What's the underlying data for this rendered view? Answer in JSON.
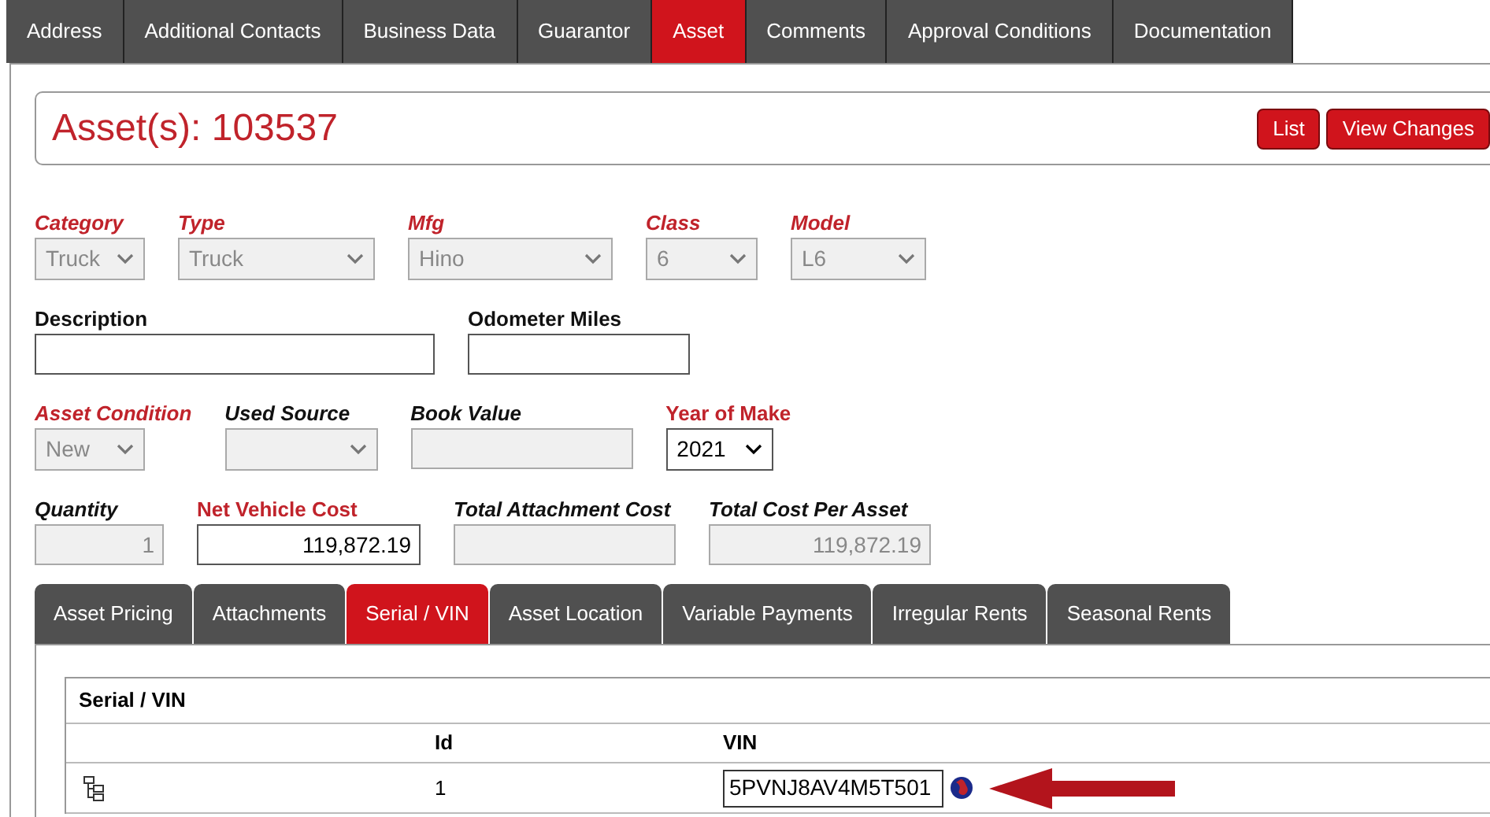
{
  "tabs": [
    {
      "label": "Address",
      "selected": false
    },
    {
      "label": "Additional Contacts",
      "selected": false
    },
    {
      "label": "Business Data",
      "selected": false
    },
    {
      "label": "Guarantor",
      "selected": false
    },
    {
      "label": "Asset",
      "selected": true
    },
    {
      "label": "Comments",
      "selected": false
    },
    {
      "label": "Approval Conditions",
      "selected": false
    },
    {
      "label": "Documentation",
      "selected": false
    }
  ],
  "header": {
    "title": "Asset(s): 103537",
    "buttons": [
      "List",
      "View Changes"
    ]
  },
  "field_rows": [
    [
      {
        "label": "Category",
        "kind": "select",
        "value": "Truck",
        "required": true,
        "italic": true,
        "disabled": true
      },
      {
        "label": "Type",
        "kind": "select",
        "value": "Truck",
        "required": true,
        "italic": true,
        "disabled": true
      },
      {
        "label": "Mfg",
        "kind": "select",
        "value": "Hino",
        "required": true,
        "italic": true,
        "disabled": true
      },
      {
        "label": "Class",
        "kind": "select",
        "value": "6",
        "required": true,
        "italic": true,
        "disabled": true
      },
      {
        "label": "Model",
        "kind": "select",
        "value": "L6",
        "required": true,
        "italic": true,
        "disabled": true
      }
    ],
    [
      {
        "label": "Description",
        "kind": "input",
        "required": false,
        "italic": false,
        "disabled": false
      },
      {
        "label": "Odometer Miles",
        "kind": "input",
        "required": false,
        "italic": false,
        "disabled": false
      }
    ],
    [
      {
        "label": "Asset Condition",
        "kind": "select",
        "value": "New",
        "required": true,
        "italic": true,
        "disabled": true
      },
      {
        "label": "Used Source",
        "kind": "select",
        "required": false,
        "italic": true,
        "disabled": true
      },
      {
        "label": "Book Value",
        "kind": "input",
        "required": false,
        "italic": true,
        "disabled": true
      },
      {
        "label": "Year of Make",
        "kind": "select",
        "value": "2021",
        "required": true,
        "italic": false,
        "disabled": false
      }
    ],
    [
      {
        "label": "Quantity",
        "kind": "input",
        "value": "1",
        "required": false,
        "italic": true,
        "disabled": true
      },
      {
        "label": "Net Vehicle Cost",
        "kind": "input",
        "value": "119,872.19",
        "required": true,
        "italic": false,
        "disabled": false
      },
      {
        "label": "Total Attachment Cost",
        "kind": "input",
        "required": false,
        "italic": true,
        "disabled": true
      },
      {
        "label": "Total Cost Per Asset",
        "kind": "input",
        "value": "119,872.19",
        "required": false,
        "italic": true,
        "disabled": true
      }
    ]
  ],
  "sub_tabs": [
    {
      "label": "Asset Pricing",
      "selected": false
    },
    {
      "label": "Attachments",
      "selected": false
    },
    {
      "label": "Serial / VIN",
      "selected": true
    },
    {
      "label": "Asset Location",
      "selected": false
    },
    {
      "label": "Variable Payments",
      "selected": false
    },
    {
      "label": "Irregular Rents",
      "selected": false
    },
    {
      "label": "Seasonal Rents",
      "selected": false
    }
  ],
  "serial_table": {
    "title": "Serial / VIN",
    "columns": [
      "Id",
      "VIN"
    ],
    "rows": [
      {
        "id": "1",
        "vin": "5PVNJ8AV4M5T501"
      }
    ]
  }
}
